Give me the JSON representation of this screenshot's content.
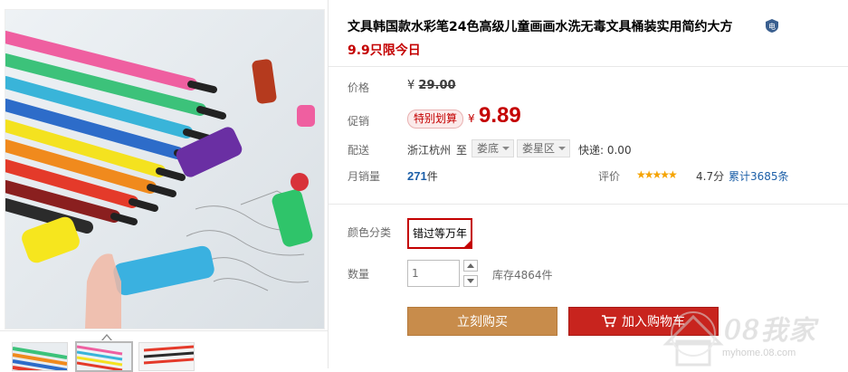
{
  "product": {
    "title": "文具韩国款水彩笔24色高级儿童画画水洗无毒文具桶装实用简约大方",
    "promo_line": "9.9只限今日"
  },
  "labels": {
    "price": "价格",
    "promotion": "促销",
    "delivery": "配送",
    "monthly_sales": "月销量",
    "rating": "评价",
    "color": "颜色分类",
    "quantity": "数量"
  },
  "pricing": {
    "currency": "¥",
    "original_price": "29.00",
    "promo_tag": "特别划算",
    "promo_price": "9.89",
    "accent_color": "#c40000"
  },
  "delivery": {
    "from": "浙江杭州",
    "to_word": "至",
    "province": "娄底",
    "district": "娄星区",
    "express": "快递: 0.00"
  },
  "sales": {
    "count": "271",
    "unit": "件"
  },
  "rating": {
    "stars": "★★★★★",
    "star_value": 4.7,
    "score_text": "4.7分",
    "reviews_text": "累计3685条"
  },
  "sku": {
    "color_options": [
      "错过等万年"
    ],
    "selected": "错过等万年"
  },
  "quantity": {
    "value": "1",
    "stock": "库存4864件"
  },
  "actions": {
    "buy_now": "立刻购买",
    "add_cart": "加入购物车"
  },
  "watermark": {
    "brand": "08我家",
    "url": "myhome.08.com"
  }
}
